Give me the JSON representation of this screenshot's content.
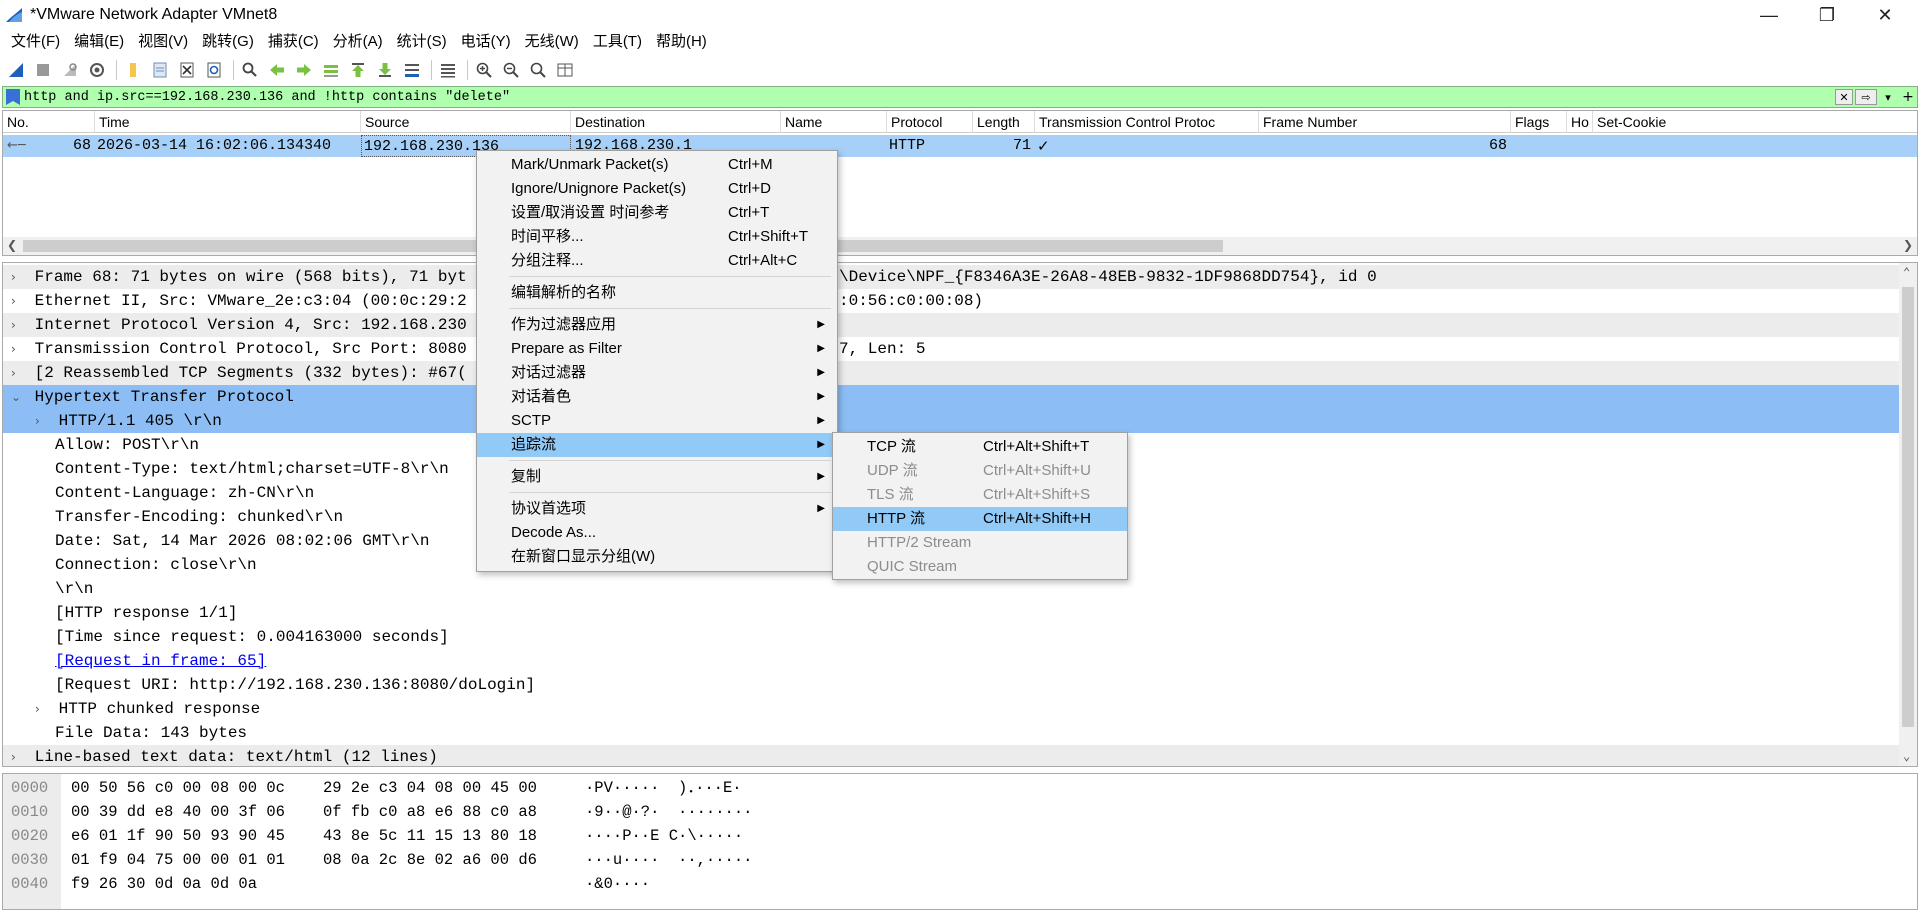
{
  "window": {
    "title": "*VMware Network Adapter VMnet8"
  },
  "menu": [
    "文件(F)",
    "编辑(E)",
    "视图(V)",
    "跳转(G)",
    "捕获(C)",
    "分析(A)",
    "统计(S)",
    "电话(Y)",
    "无线(W)",
    "工具(T)",
    "帮助(H)"
  ],
  "filter": {
    "text": "http and ip.src==192.168.230.136 and !http contains \"delete\"",
    "clear_glyph": "✕",
    "apply_glyph": "⇨",
    "dropdown_glyph": "▾",
    "add_glyph": "+"
  },
  "packet_list": {
    "columns": [
      "No.",
      "Time",
      "Source",
      "Destination",
      "Name",
      "Protocol",
      "Length",
      "Transmission Control Protoc",
      "Frame Number",
      "Flags",
      "Ho",
      "Set-Cookie"
    ],
    "row": {
      "no": "68",
      "time": "2026-03-14 16:02:06.134340",
      "source": "192.168.230.136",
      "destination": "192.168.230.1",
      "name": "",
      "protocol": "HTTP",
      "length": "71",
      "tcp": "✓",
      "frame_number": "68"
    }
  },
  "details": [
    {
      "text": "Frame 68: 71 bytes on wire (568 bits), 71 byt",
      "tail": "\\Device\\NPF_{F8346A3E-26A8-48EB-9832-1DF9868DD754}, id 0",
      "exp": "›"
    },
    {
      "text": "Ethernet II, Src: VMware_2e:c3:04 (00:0c:29:2",
      "tail": ":0:56:c0:00:08)",
      "exp": "›"
    },
    {
      "text": "Internet Protocol Version 4, Src: 192.168.230",
      "tail": "",
      "exp": "›"
    },
    {
      "text": "Transmission Control Protocol, Src Port: 8080",
      "tail": "7, Len: 5",
      "exp": "›"
    },
    {
      "text": "[2 Reassembled TCP Segments (332 bytes): #67(",
      "tail": "",
      "exp": "›"
    },
    {
      "text": "Hypertext Transfer Protocol",
      "exp": "⌄"
    },
    {
      "text": "HTTP/1.1 405 \\r\\n",
      "exp": "›"
    },
    {
      "text": "Allow: POST\\r\\n"
    },
    {
      "text": "Content-Type: text/html;charset=UTF-8\\r\\n"
    },
    {
      "text": "Content-Language: zh-CN\\r\\n"
    },
    {
      "text": "Transfer-Encoding: chunked\\r\\n"
    },
    {
      "text": "Date: Sat, 14 Mar 2026 08:02:06 GMT\\r\\n"
    },
    {
      "text": "Connection: close\\r\\n"
    },
    {
      "text": "\\r\\n"
    },
    {
      "text": "[HTTP response 1/1]"
    },
    {
      "text": "[Time since request: 0.004163000 seconds]"
    },
    {
      "text": "[Request in frame: 65]"
    },
    {
      "text": "[Request URI: http://192.168.230.136:8080/doLogin]"
    },
    {
      "text": "HTTP chunked response",
      "exp": "›"
    },
    {
      "text": "File Data: 143 bytes"
    },
    {
      "text": "Line-based text data: text/html (12 lines)",
      "exp": "›"
    }
  ],
  "hex": [
    {
      "off": "0000",
      "b1": "00 50 56 c0 00 08 00 0c",
      "b2": "29 2e c3 04 08 00 45 00",
      "ascii": "·PV·····  )．···E·"
    },
    {
      "off": "0010",
      "b1": "00 39 dd e8 40 00 3f 06",
      "b2": "0f fb c0 a8 e6 88 c0 a8",
      "ascii": "·9··@·?·  ········"
    },
    {
      "off": "0020",
      "b1": "e6 01 1f 90 50 93 90 45",
      "b2": "43 8e 5c 11 15 13 80 18",
      "ascii": "····P··E C·\\·····"
    },
    {
      "off": "0030",
      "b1": "01 f9 04 75 00 00 01 01",
      "b2": "08 0a 2c 8e 02 a6 00 d6",
      "ascii": "···u····  ··,·····"
    },
    {
      "off": "0040",
      "b1": "f9 26 30 0d 0a 0d 0a",
      "b2": "",
      "ascii": "·&0····"
    }
  ],
  "context_menu": {
    "items": [
      {
        "label": "Mark/Unmark Packet(s)",
        "key": "Ctrl+M"
      },
      {
        "label": "Ignore/Unignore Packet(s)",
        "key": "Ctrl+D"
      },
      {
        "label": "设置/取消设置 时间参考",
        "key": "Ctrl+T"
      },
      {
        "label": "时间平移...",
        "key": "Ctrl+Shift+T"
      },
      {
        "label": "分组注释...",
        "key": "Ctrl+Alt+C"
      },
      {
        "label": "编辑解析的名称",
        "key": ""
      },
      {
        "label": "作为过滤器应用",
        "key": ""
      },
      {
        "label": "Prepare as Filter",
        "key": ""
      },
      {
        "label": "对话过滤器",
        "key": ""
      },
      {
        "label": "对话着色",
        "key": ""
      },
      {
        "label": "SCTP",
        "key": ""
      },
      {
        "label": "追踪流",
        "key": ""
      },
      {
        "label": "复制",
        "key": ""
      },
      {
        "label": "协议首选项",
        "key": ""
      },
      {
        "label": "Decode As...",
        "key": ""
      },
      {
        "label": "在新窗口显示分组(W)",
        "key": ""
      }
    ]
  },
  "submenu": {
    "items": [
      {
        "label": "TCP 流",
        "key": "Ctrl+Alt+Shift+T"
      },
      {
        "label": "UDP 流",
        "key": "Ctrl+Alt+Shift+U"
      },
      {
        "label": "TLS 流",
        "key": "Ctrl+Alt+Shift+S"
      },
      {
        "label": "HTTP 流",
        "key": "Ctrl+Alt+Shift+H"
      },
      {
        "label": "HTTP/2 Stream",
        "key": ""
      },
      {
        "label": "QUIC Stream",
        "key": ""
      }
    ]
  }
}
